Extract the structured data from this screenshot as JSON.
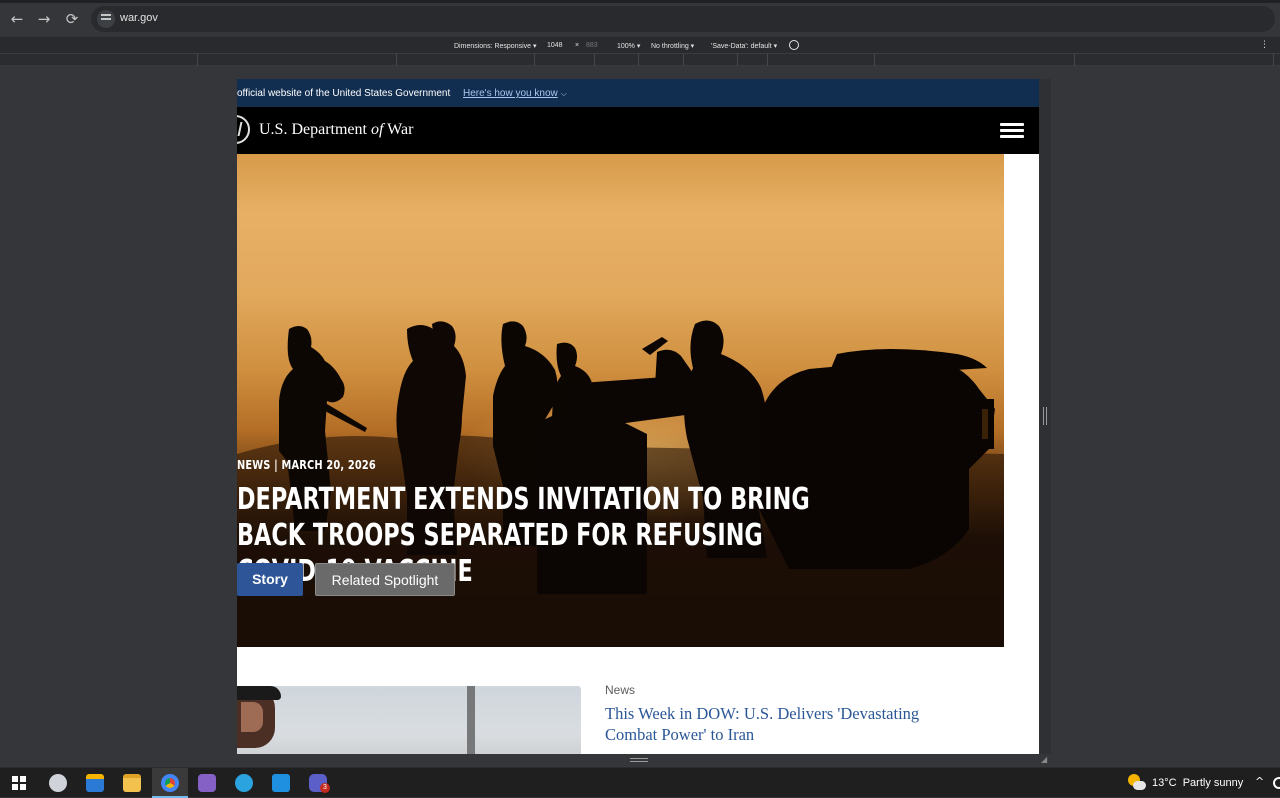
{
  "browser": {
    "url": "war.gov",
    "devtools": {
      "dimensions_label": "Dimensions: Responsive ▾",
      "width": "1048",
      "times": "×",
      "height": "883",
      "zoom": "100% ▾",
      "throttling": "No throttling ▾",
      "save_data": "'Save-Data': default ▾"
    }
  },
  "gov_banner": {
    "official_text": "official website of the United States Government",
    "how_text": "Here's how you know"
  },
  "header": {
    "title_pre": "U.S. Department ",
    "title_of": "of",
    "title_post": " War"
  },
  "hero": {
    "kicker": "NEWS | MARCH 20, 2026",
    "headline": "Department Extends Invitation to Bring Back Troops Separated for Refusing COVID-19 Vaccine",
    "story_label": "Story",
    "related_label": "Related Spotlight"
  },
  "news_card": {
    "label": "News",
    "title": "This Week in DOW: U.S. Delivers 'Devastating Combat Power' to Iran"
  },
  "taskbar": {
    "weather_temp": "13°C",
    "weather_desc": "Partly sunny",
    "teams_badge": "3"
  },
  "colors": {
    "gov_banner": "#112e51",
    "story_button": "#2e5597",
    "link": "#2b5797"
  }
}
